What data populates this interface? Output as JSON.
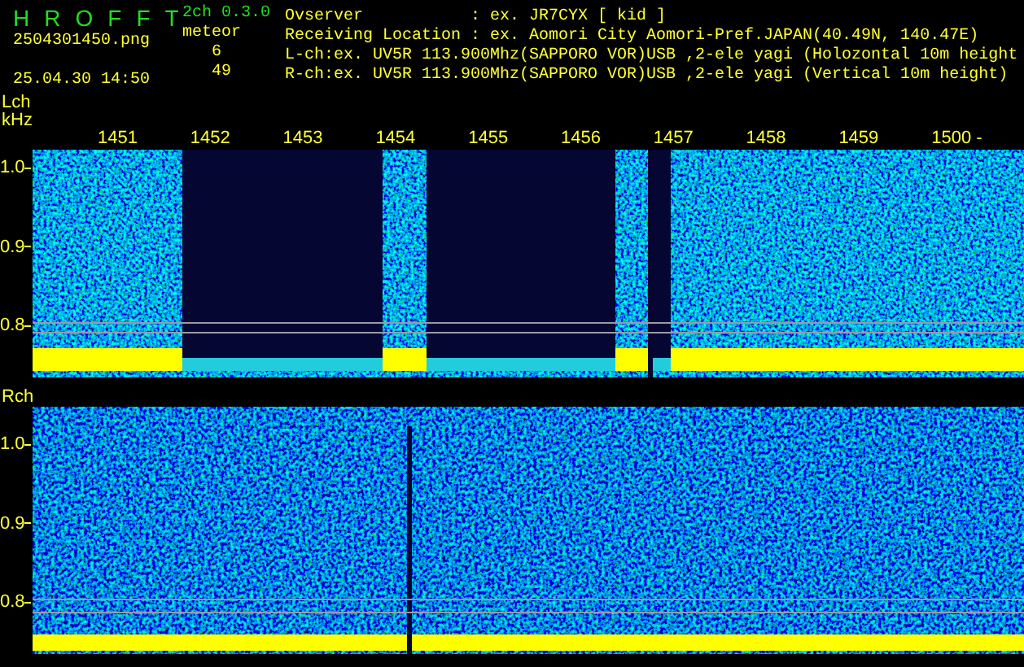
{
  "app": {
    "title_letters": [
      "H",
      "R",
      "O",
      "F",
      "F",
      "T"
    ],
    "version": "2ch 0.3.0",
    "filename": "2504301450.png",
    "datetime": "25.04.30 14:50",
    "count_label": "meteor",
    "counts": [
      "6",
      "49"
    ]
  },
  "info_lines": [
    "Ovserver           : ex. JR7CYX [ kid ]",
    "Receiving Location : ex. Aomori City Aomori-Pref.JAPAN(40.49N, 140.47E)",
    "L-ch:ex. UV5R 113.900Mhz(SAPPORO VOR)USB ,2-ele yagi (Holozontal 10m height",
    "R-ch:ex. UV5R 113.900Mhz(SAPPORO VOR)USB ,2-ele yagi (Vertical 10m height)"
  ],
  "channels": [
    {
      "label": "Lch",
      "unit": "kHz",
      "kind": "gapped",
      "time_labels": [
        "1451",
        "1452",
        "1453",
        "1454",
        "1455",
        "1456",
        "1457",
        "1458",
        "1459",
        "1500 -"
      ],
      "y_labels": [
        "1.0",
        "0.9",
        "0.8"
      ]
    },
    {
      "label": "Rch",
      "kind": "steady",
      "y_labels": [
        "1.0",
        "0.9",
        "0.8"
      ]
    }
  ]
}
